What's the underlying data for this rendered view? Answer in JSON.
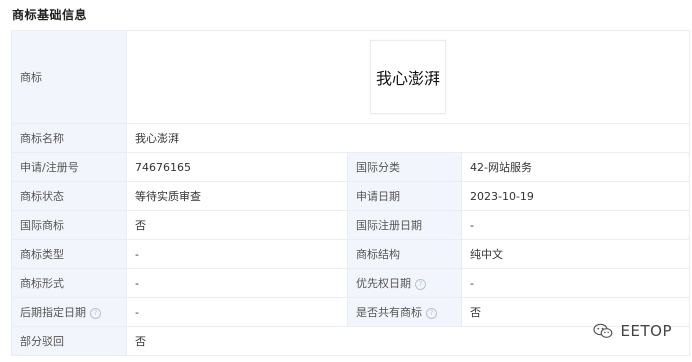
{
  "section": {
    "title": "商标基础信息"
  },
  "logo": {
    "label": "商标",
    "text": "我心澎湃"
  },
  "rows": [
    {
      "l1": "商标名称",
      "v1": "我心澎湃"
    },
    {
      "l1": "申请/注册号",
      "v1": "74676165",
      "l2": "国际分类",
      "v2": "42-网站服务"
    },
    {
      "l1": "商标状态",
      "v1": "等待实质审查",
      "l2": "申请日期",
      "v2": "2023-10-19"
    },
    {
      "l1": "国际商标",
      "v1": "否",
      "l2": "国际注册日期",
      "v2": "-"
    },
    {
      "l1": "商标类型",
      "v1": "-",
      "l2": "商标结构",
      "v2": "纯中文"
    },
    {
      "l1": "商标形式",
      "v1": "-",
      "l2": "优先权日期",
      "v2": "-"
    },
    {
      "l1": "后期指定日期",
      "v1": "-",
      "l2": "是否共有商标",
      "v2": "否"
    },
    {
      "l1": "部分驳回",
      "v1": "否"
    }
  ],
  "help_glyph": "?",
  "watermark": {
    "text": "EETOP",
    "icon": "wechat-icon"
  }
}
